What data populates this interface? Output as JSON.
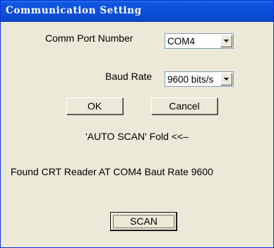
{
  "window": {
    "title": "Communication Setting"
  },
  "comm_port": {
    "label": "Comm Port Number",
    "value": "COM4"
  },
  "baud_rate": {
    "label": "Baud Rate",
    "value": "9600 bits/s"
  },
  "buttons": {
    "ok": "OK",
    "cancel": "Cancel",
    "scan": "SCAN"
  },
  "auto_scan": {
    "toggle_text": "'AUTO SCAN' Fold <<–"
  },
  "status": {
    "message": "Found CRT Reader AT COM4 Baut Rate 9600"
  },
  "colors": {
    "titlebar": "#0a4fd4",
    "face": "#ece9d8",
    "combo_border": "#7f9db9"
  }
}
